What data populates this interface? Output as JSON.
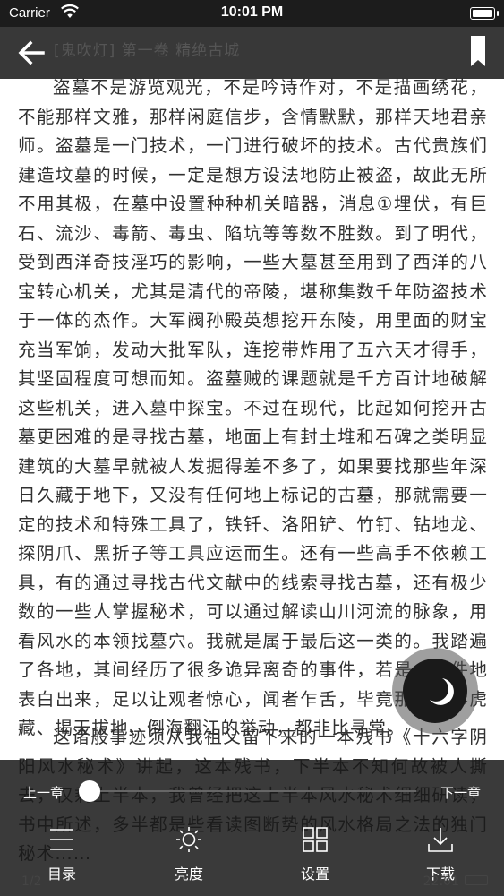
{
  "status_bar": {
    "carrier": "Carrier",
    "time": "10:01 PM"
  },
  "nav": {
    "chapter_title": "[鬼吹灯] 第一卷 精绝古城",
    "back_icon": "arrow-left-icon",
    "bookmark_icon": "bookmark-icon"
  },
  "content": {
    "paragraph_1": "盗墓不是游览观光，不是吟诗作对，不是描画绣花，不能那样文雅，那样闲庭信步，含情默默，那样天地君亲师。盗墓是一门技术，一门进行破坏的技术。古代贵族们建造坟墓的时候，一定是想方设法地防止被盗，故此无所不用其极，在墓中设置种种机关暗器，消息①埋伏，有巨石、流沙、毒箭、毒虫、陷坑等等数不胜数。到了明代，受到西洋奇技淫巧的影响，一些大墓甚至用到了西洋的八宝转心机关，尤其是清代的帝陵，堪称集数千年防盗技术于一体的杰作。大军阀孙殿英想挖开东陵，用里面的财宝充当军饷，发动大批军队，连挖带炸用了五六天才得手，其坚固程度可想而知。盗墓贼的课题就是千方百计地破解这些机关，进入墓中探宝。不过在现代，比起如何挖开古墓更困难的是寻找古墓，地面上有封土堆和石碑之类明显建筑的大墓早就被人发掘得差不多了，如果要找那些年深日久藏于地下，又没有任何地上标记的古墓，那就需要一定的技术和特殊工具了，铁钎、洛阳铲、竹钉、钻地龙、探阴爪、黑折子等工具应运而生。还有一些高手不依赖工具，有的通过寻找古代文献中的线索寻找古墓，还有极少数的一些人掌握秘术，可以通过解读山川河流的脉象，用看风水的本领找墓穴。我就是属于最后这一类的。我踏遍了各地，其间经历了很多诡异离奇的事件，若是一件件地表白出来，足以让观者惊心，闻者乍舌，毕竟那些龙形虎藏、揭天拔地、倒海翻江的举动，都非比寻常。",
    "paragraph_2": "这诸般事迹须从我祖父留下来的一本残书《十六字阴阳风水秘术》讲起，这本残书，下半本不知何故被人撕去，仅剩上半本，我曾经把这上半本风水秘术细细研读，书中所述，多半都是些看读图断势的风水格局之法的独门秘术……"
  },
  "bottom_panel": {
    "prev_chapter": "上一章",
    "next_chapter": "下一章",
    "progress": 0.0,
    "menu": [
      {
        "label": "目录",
        "icon": "list-icon"
      },
      {
        "label": "亮度",
        "icon": "brightness-icon"
      },
      {
        "label": "设置",
        "icon": "grid-settings-icon"
      },
      {
        "label": "下载",
        "icon": "download-icon"
      }
    ],
    "page_number": "1/2",
    "clock": "22:01"
  },
  "floating": {
    "night_mode_icon": "moon-icon"
  }
}
